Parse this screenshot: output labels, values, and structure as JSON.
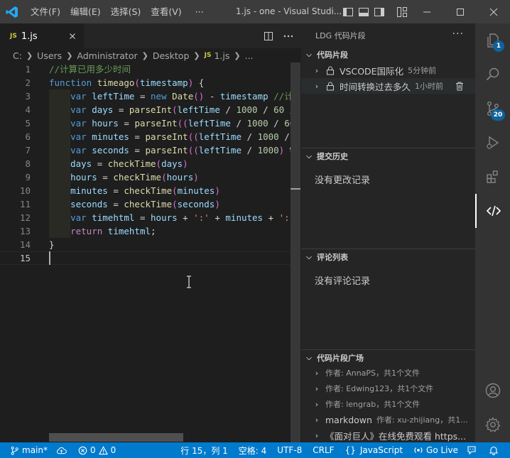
{
  "titlebar": {
    "menu": [
      "文件(F)",
      "编辑(E)",
      "选择(S)",
      "查看(V)",
      "···"
    ],
    "title": "1.js - one - Visual Studi..."
  },
  "editor": {
    "tab": {
      "badge": "JS",
      "label": "1.js"
    },
    "breadcrumb": [
      "C:",
      "Users",
      "Administrator",
      "Desktop",
      "1.js",
      "..."
    ],
    "line_numbers": [
      "1",
      "2",
      "3",
      "4",
      "5",
      "6",
      "7",
      "8",
      "9",
      "10",
      "11",
      "12",
      "13",
      "14",
      "15"
    ],
    "active_line": 15,
    "code": [
      [
        [
          "c-com",
          "//计算已用多少时间"
        ]
      ],
      [
        [
          "c-kw",
          "function "
        ],
        [
          "c-fn",
          "timeago"
        ],
        [
          "c-br",
          "("
        ],
        [
          "c-var",
          "timestamp"
        ],
        [
          "c-br",
          ")"
        ],
        [
          "c-pl",
          " {"
        ]
      ],
      [
        [
          "c-pl",
          "    "
        ],
        [
          "c-kw",
          "var "
        ],
        [
          "c-var",
          "leftTime"
        ],
        [
          "c-pl",
          " = "
        ],
        [
          "c-kw",
          "new "
        ],
        [
          "c-fn",
          "Date"
        ],
        [
          "c-br",
          "()"
        ],
        [
          "c-pl",
          " - "
        ],
        [
          "c-var",
          "timestamp"
        ],
        [
          "c-pl",
          " "
        ],
        [
          "c-com",
          "//计"
        ]
      ],
      [
        [
          "c-pl",
          "    "
        ],
        [
          "c-kw",
          "var "
        ],
        [
          "c-var",
          "days"
        ],
        [
          "c-pl",
          " = "
        ],
        [
          "c-fn",
          "parseInt"
        ],
        [
          "c-br",
          "("
        ],
        [
          "c-var",
          "leftTime"
        ],
        [
          "c-pl",
          " / "
        ],
        [
          "c-num",
          "1000"
        ],
        [
          "c-pl",
          " / "
        ],
        [
          "c-num",
          "60"
        ],
        [
          "c-pl",
          " /"
        ]
      ],
      [
        [
          "c-pl",
          "    "
        ],
        [
          "c-kw",
          "var "
        ],
        [
          "c-var",
          "hours"
        ],
        [
          "c-pl",
          " = "
        ],
        [
          "c-fn",
          "parseInt"
        ],
        [
          "c-br",
          "(("
        ],
        [
          "c-var",
          "leftTime"
        ],
        [
          "c-pl",
          " / "
        ],
        [
          "c-num",
          "1000"
        ],
        [
          "c-pl",
          " / "
        ],
        [
          "c-num",
          "60"
        ]
      ],
      [
        [
          "c-pl",
          "    "
        ],
        [
          "c-kw",
          "var "
        ],
        [
          "c-var",
          "minutes"
        ],
        [
          "c-pl",
          " = "
        ],
        [
          "c-fn",
          "parseInt"
        ],
        [
          "c-br",
          "(("
        ],
        [
          "c-var",
          "leftTime"
        ],
        [
          "c-pl",
          " / "
        ],
        [
          "c-num",
          "1000"
        ],
        [
          "c-pl",
          " /"
        ]
      ],
      [
        [
          "c-pl",
          "    "
        ],
        [
          "c-kw",
          "var "
        ],
        [
          "c-var",
          "seconds"
        ],
        [
          "c-pl",
          " = "
        ],
        [
          "c-fn",
          "parseInt"
        ],
        [
          "c-br",
          "(("
        ],
        [
          "c-var",
          "leftTime"
        ],
        [
          "c-pl",
          " / "
        ],
        [
          "c-num",
          "1000"
        ],
        [
          "c-br",
          ")"
        ],
        [
          "c-pl",
          " %"
        ]
      ],
      [
        [
          "c-pl",
          "    "
        ],
        [
          "c-var",
          "days"
        ],
        [
          "c-pl",
          " = "
        ],
        [
          "c-fn",
          "checkTime"
        ],
        [
          "c-br",
          "("
        ],
        [
          "c-var",
          "days"
        ],
        [
          "c-br",
          ")"
        ]
      ],
      [
        [
          "c-pl",
          "    "
        ],
        [
          "c-var",
          "hours"
        ],
        [
          "c-pl",
          " = "
        ],
        [
          "c-fn",
          "checkTime"
        ],
        [
          "c-br",
          "("
        ],
        [
          "c-var",
          "hours"
        ],
        [
          "c-br",
          ")"
        ]
      ],
      [
        [
          "c-pl",
          "    "
        ],
        [
          "c-var",
          "minutes"
        ],
        [
          "c-pl",
          " = "
        ],
        [
          "c-fn",
          "checkTime"
        ],
        [
          "c-br",
          "("
        ],
        [
          "c-var",
          "minutes"
        ],
        [
          "c-br",
          ")"
        ]
      ],
      [
        [
          "c-pl",
          "    "
        ],
        [
          "c-var",
          "seconds"
        ],
        [
          "c-pl",
          " = "
        ],
        [
          "c-fn",
          "checkTime"
        ],
        [
          "c-br",
          "("
        ],
        [
          "c-var",
          "seconds"
        ],
        [
          "c-br",
          ")"
        ]
      ],
      [
        [
          "c-pl",
          "    "
        ],
        [
          "c-kw",
          "var "
        ],
        [
          "c-var",
          "timehtml"
        ],
        [
          "c-pl",
          " = "
        ],
        [
          "c-var",
          "hours"
        ],
        [
          "c-pl",
          " + "
        ],
        [
          "c-str",
          "':'"
        ],
        [
          "c-pl",
          " + "
        ],
        [
          "c-var",
          "minutes"
        ],
        [
          "c-pl",
          " + "
        ],
        [
          "c-str",
          "':'"
        ]
      ],
      [
        [
          "c-pl",
          "    "
        ],
        [
          "c-ctl",
          "return "
        ],
        [
          "c-var",
          "timehtml"
        ],
        [
          "c-pl",
          ";"
        ]
      ],
      [
        [
          "c-pl",
          "}"
        ]
      ],
      [
        [
          "c-pl",
          ""
        ]
      ]
    ]
  },
  "sidepanel": {
    "title": "LDG 代码片段",
    "more": "···",
    "snippets": {
      "header": "代码片段",
      "items": [
        {
          "title": "VSCODE国际化",
          "time": "5分钟前"
        },
        {
          "title": "时间转换过去多久",
          "time": "1小时前"
        }
      ]
    },
    "history": {
      "header": "提交历史",
      "empty": "没有更改记录"
    },
    "comments": {
      "header": "评论列表",
      "empty": "没有评论记录"
    },
    "square": {
      "header": "代码片段广场",
      "items": [
        {
          "title": "",
          "desc": "作者: AnnaPS，共1个文件"
        },
        {
          "title": "",
          "desc": "作者: Edwing123，共1个文件"
        },
        {
          "title": "",
          "desc": "作者: lengrab，共1个文件"
        },
        {
          "title": "markdown",
          "desc": "作者: xu-zhijiang，共1..."
        },
        {
          "title": "《面对巨人》在线免费观看 https...",
          "desc": ""
        }
      ]
    }
  },
  "activitybar": {
    "explorer_badge": "1",
    "scm_badge": "20"
  },
  "statusbar": {
    "branch": "main*",
    "errors": "0",
    "warnings": "0",
    "position": "行 15，列 1",
    "spaces": "空格: 4",
    "encoding": "UTF-8",
    "eol": "CRLF",
    "language": "JavaScript",
    "golive": "Go Live"
  },
  "colors": {
    "accent": "#007acc",
    "badge": "#0e639c"
  }
}
